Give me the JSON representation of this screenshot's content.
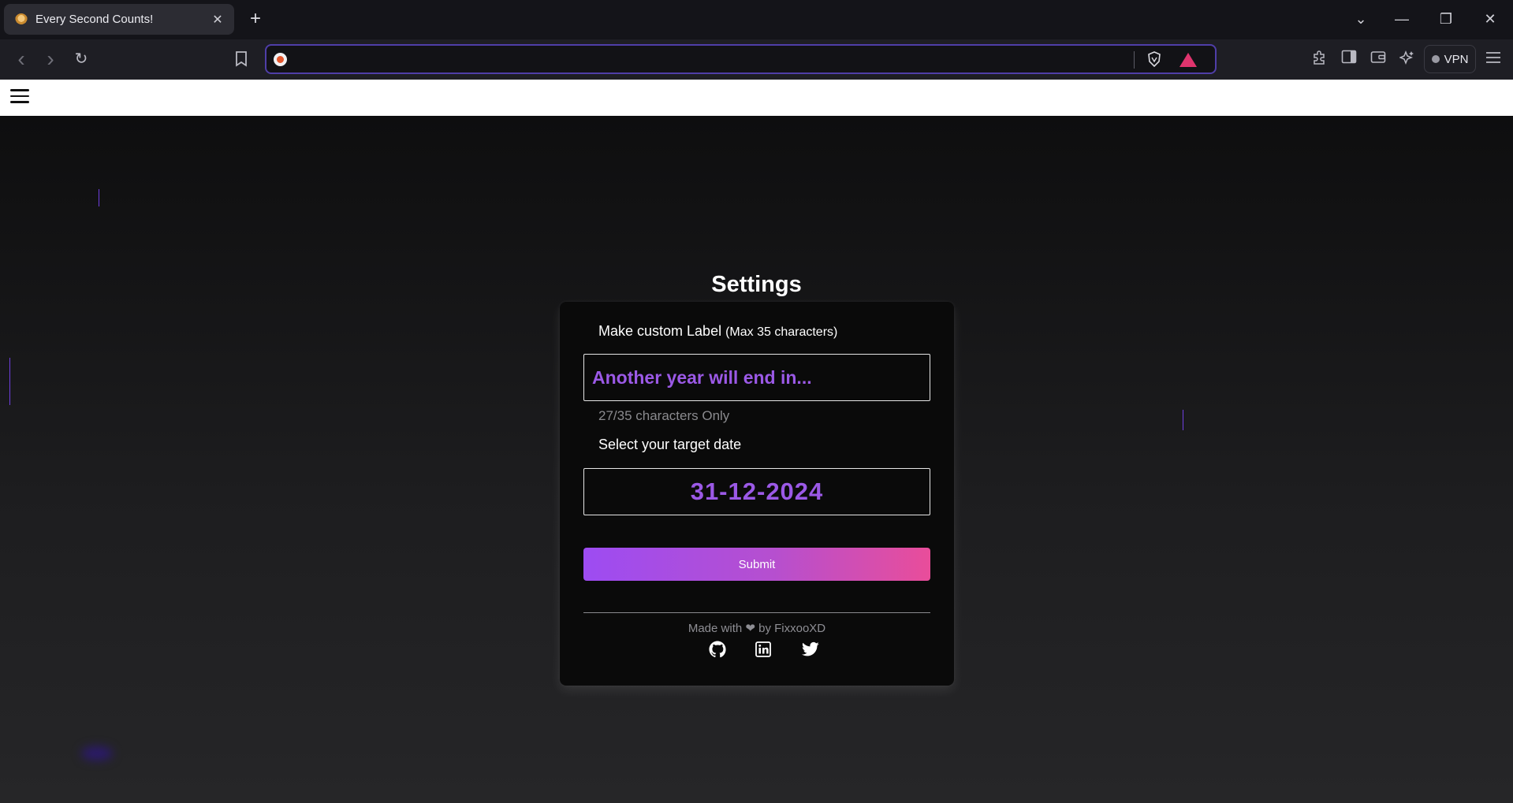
{
  "browser": {
    "tab": {
      "title": "Every Second Counts!",
      "close": "✕"
    },
    "new_tab": "+",
    "window_controls": {
      "tab_search": "⌄",
      "minimize": "—",
      "restore": "❐",
      "close": "✕"
    },
    "toolbar": {
      "back": "‹",
      "forward": "›",
      "reload": "↻",
      "bookmark": "🔖",
      "url": "",
      "vpn_label": "VPN",
      "icons": [
        "extensions-icon",
        "sidebar-icon",
        "wallet-icon",
        "leo-ai-icon",
        "menu-icon"
      ]
    }
  },
  "page": {
    "title": "Settings",
    "label_field": {
      "label": "Make custom Label",
      "hint": "(Max 35 characters)",
      "value": "Another year will end in...",
      "char_count": "27/35 characters Only"
    },
    "date_field": {
      "label": "Select your target date",
      "value": "31-12-2024"
    },
    "submit_label": "Submit",
    "footer": {
      "made_with": "Made with ❤ by FixxooXD",
      "social": [
        "github-icon",
        "linkedin-icon",
        "twitter-icon"
      ]
    }
  },
  "colors": {
    "accent_purple": "#9b59e6",
    "gradient_start": "#9d4cf2",
    "gradient_end": "#e94d9a",
    "url_focus_border": "#4f3ea8"
  }
}
